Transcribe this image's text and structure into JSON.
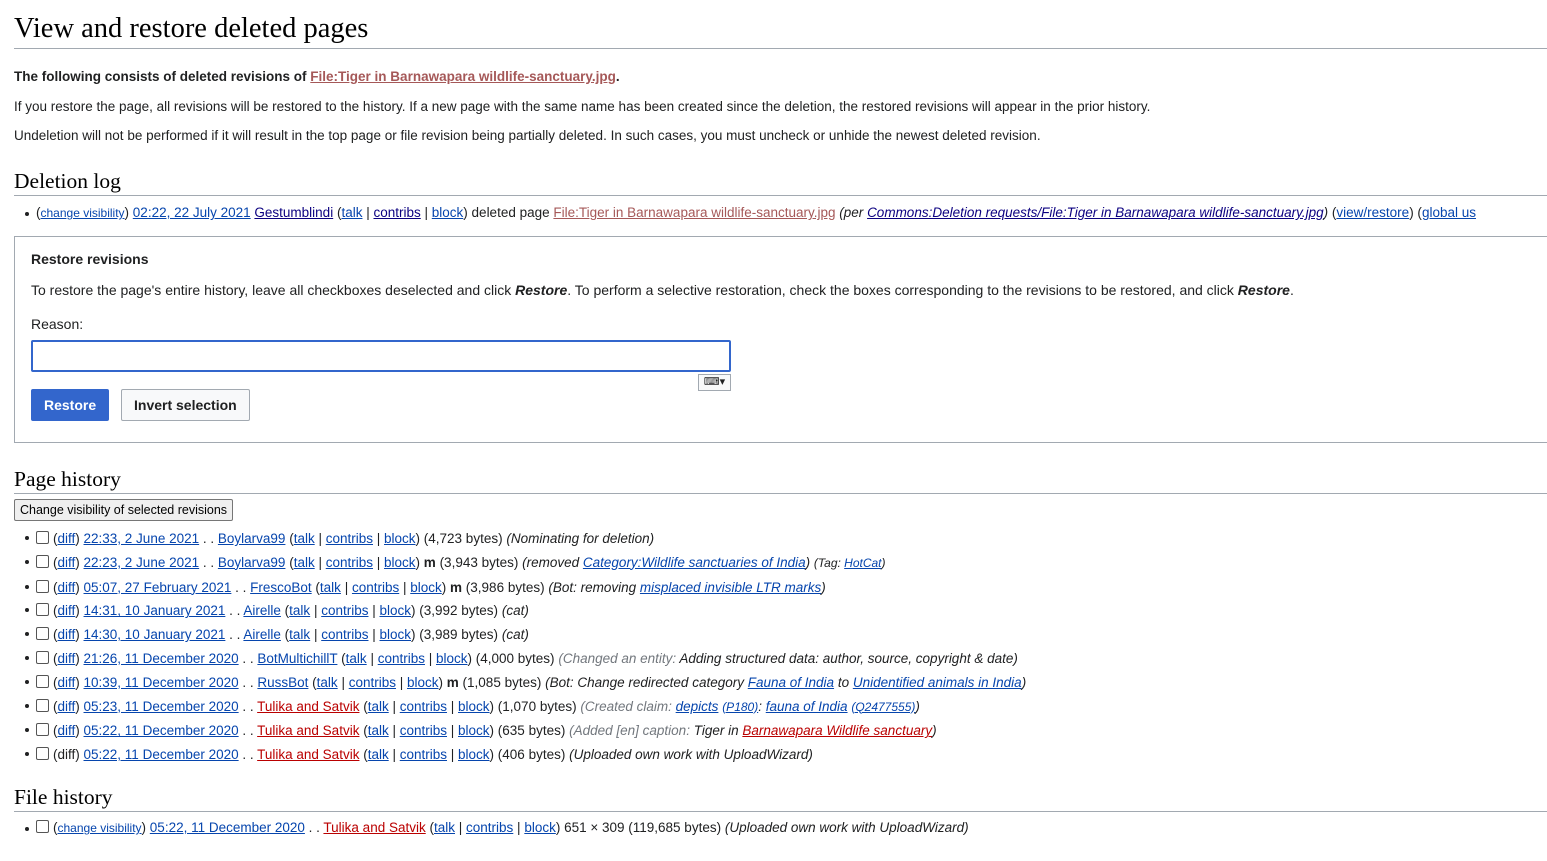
{
  "title": "View and restore deleted pages",
  "intro": {
    "line1_prefix": "The following consists of deleted revisions of ",
    "file_link": "File:Tiger in Barnawapara wildlife-sanctuary.jpg",
    "line1_suffix": ".",
    "line2": "If you restore the page, all revisions will be restored to the history. If a new page with the same name has been created since the deletion, the restored revisions will appear in the prior history.",
    "line3": "Undeletion will not be performed if it will result in the top page or file revision being partially deleted. In such cases, you must uncheck or unhide the newest deleted revision."
  },
  "deletion_log": {
    "heading": "Deletion log",
    "entry": {
      "change_visibility": "change visibility",
      "timestamp": "02:22, 22 July 2021",
      "user": "Gestumblindi",
      "talk": "talk",
      "contribs": "contribs",
      "block": "block",
      "action": "deleted page",
      "page": "File:Tiger in Barnawapara wildlife-sanctuary.jpg",
      "per": "per",
      "reason_link": "Commons:Deletion requests/File:Tiger in Barnawapara wildlife-sanctuary.jpg",
      "view_restore": "view/restore",
      "global": "global us"
    }
  },
  "restore": {
    "title": "Restore revisions",
    "desc_1": "To restore the page's entire history, leave all checkboxes deselected and click ",
    "desc_restore": "Restore",
    "desc_2": ". To perform a selective restoration, check the boxes corresponding to the revisions to be restored, and click ",
    "desc_end": ".",
    "reason_label": "Reason:",
    "reason_value": "",
    "keyboard_glyph": "⌨▾",
    "restore_button": "Restore",
    "invert_button": "Invert selection"
  },
  "page_history": {
    "heading": "Page history",
    "visibility_button": "Change visibility of selected revisions",
    "diff": "diff",
    "talk": "talk",
    "contribs": "contribs",
    "block": "block",
    "minor": "m",
    "revisions": [
      {
        "time": "22:33, 2 June 2021",
        "user": "Boylarva99",
        "bytes": "(4,723 bytes)",
        "summary": "(Nominating for deletion)"
      },
      {
        "time": "22:23, 2 June 2021",
        "user": "Boylarva99",
        "bytes": "(3,943 bytes)",
        "summary_pre": "(removed ",
        "summary_link": "Category:Wildlife sanctuaries of India",
        "summary_post": ")",
        "tag_pre": "(Tag: ",
        "tag": "HotCat",
        "tag_post": ")"
      },
      {
        "time": "05:07, 27 February 2021",
        "user": "FrescoBot",
        "bytes": "(3,986 bytes)",
        "summary_pre": "(Bot: removing ",
        "summary_link": "misplaced invisible LTR marks",
        "summary_post": ")"
      },
      {
        "time": "14:31, 10 January 2021",
        "user": "Airelle",
        "bytes": "(3,992 bytes)",
        "summary": "(cat)"
      },
      {
        "time": "14:30, 10 January 2021",
        "user": "Airelle",
        "bytes": "(3,989 bytes)",
        "summary": "(cat)"
      },
      {
        "time": "21:26, 11 December 2020",
        "user": "BotMultichillT",
        "bytes": "(4,000 bytes)",
        "summary_grey": "(Changed an entity: ",
        "summary": "Adding structured data: author, source, copyright & date)"
      },
      {
        "time": "10:39, 11 December 2020",
        "user": "RussBot",
        "bytes": "(1,085 bytes)",
        "summary_pre": "(Bot: Change redirected category ",
        "link1": "Fauna of India",
        "mid": " to ",
        "link2": "Unidentified animals in India",
        "summary_post": ")"
      },
      {
        "time": "05:23, 11 December 2020",
        "user": "Tulika and Satvik",
        "bytes": "(1,070 bytes)",
        "summary_grey": "(Created claim: ",
        "link1": "depicts",
        "p1": "(P180)",
        "sep": ": ",
        "link2": "fauna of India",
        "p2": "(Q2477555)",
        "summary_post": ")"
      },
      {
        "time": "05:22, 11 December 2020",
        "user": "Tulika and Satvik",
        "bytes": "(635 bytes)",
        "summary_grey": "(Added [en] caption: ",
        "summary": "Tiger in ",
        "link1": "Barnawapara Wildlife sanctuary",
        "summary_post": ")"
      },
      {
        "time": "05:22, 11 December 2020",
        "user": "Tulika and Satvik",
        "bytes": "(406 bytes)",
        "summary": "(Uploaded own work with UploadWizard)"
      }
    ]
  },
  "file_history": {
    "heading": "File history",
    "entry": {
      "change_visibility": "change visibility",
      "time": "05:22, 11 December 2020",
      "user": "Tulika and Satvik",
      "talk": "talk",
      "contribs": "contribs",
      "block": "block",
      "dims": "651 × 309 (119,685 bytes)",
      "summary": "(Uploaded own work with UploadWizard)"
    }
  }
}
